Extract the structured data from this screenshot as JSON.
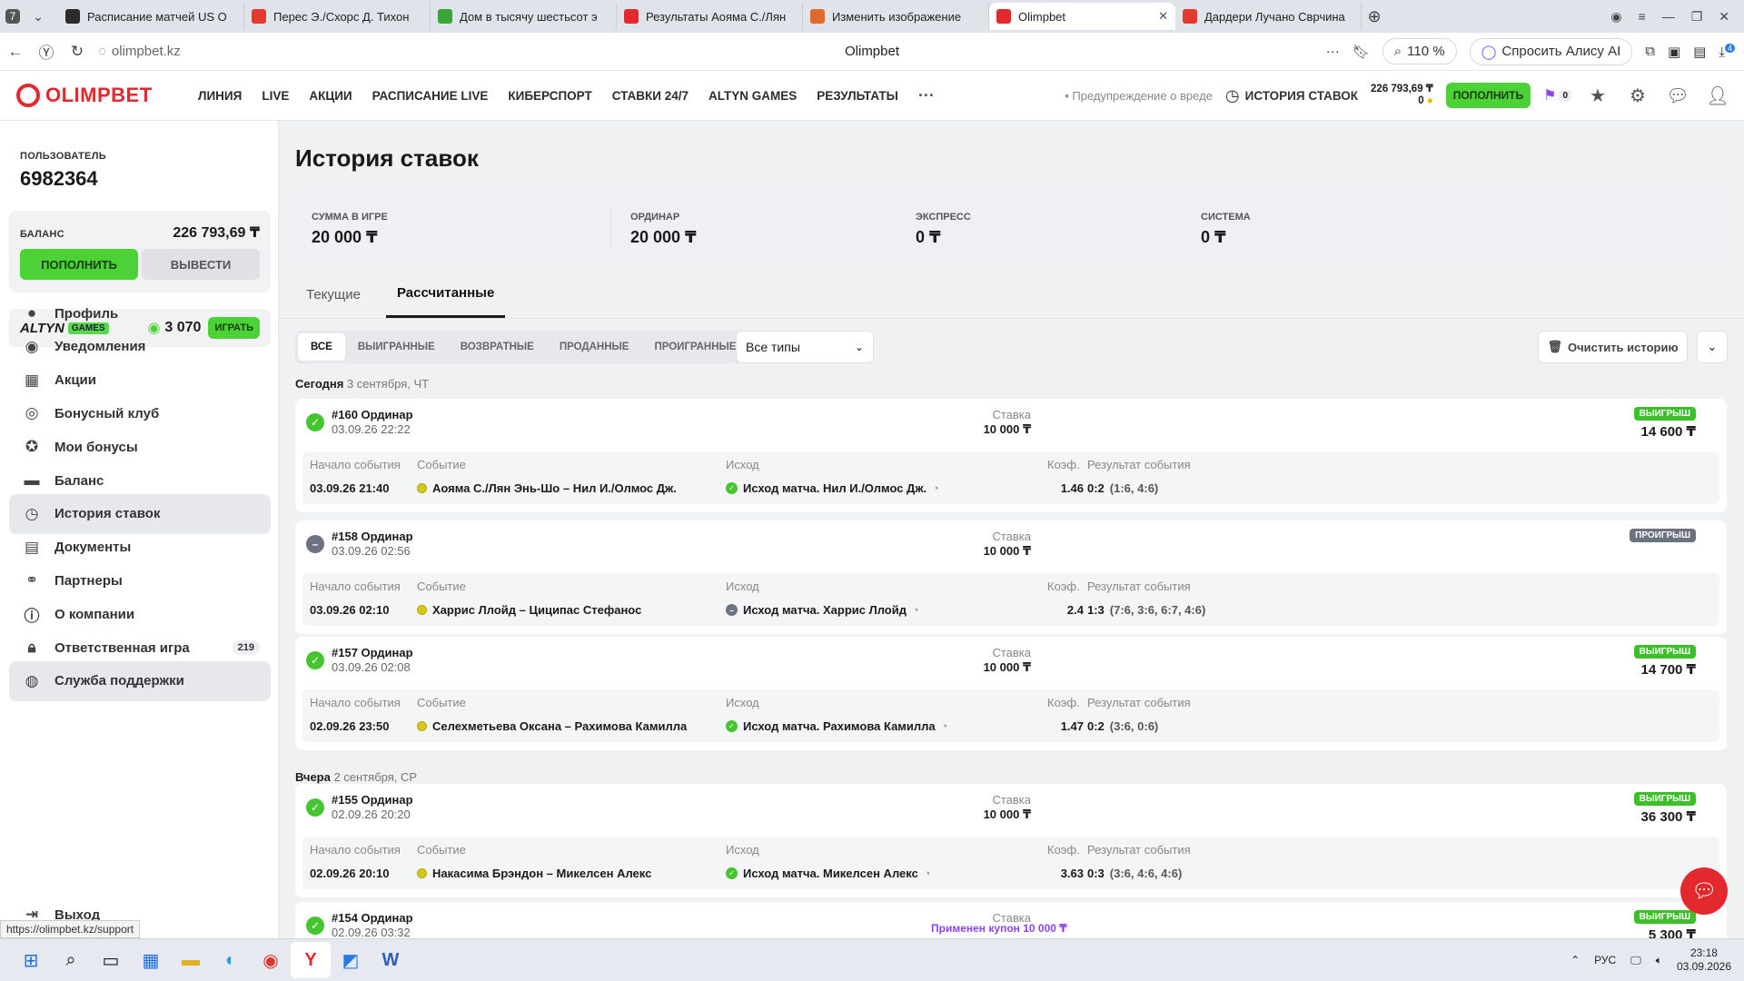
{
  "browser": {
    "tabs": [
      {
        "title": "Расписание матчей US O",
        "color": "#2b2b2b"
      },
      {
        "title": "Перес Э./Схорс Д. Тихон",
        "color": "#e23a2e"
      },
      {
        "title": "Дом в тысячу шестьсот э",
        "color": "#3aa63a"
      },
      {
        "title": "Результаты Аояма С./Лян",
        "color": "#e3282e"
      },
      {
        "title": "Изменить изображение",
        "color": "#e06a2e"
      },
      {
        "title": "Olimpbet",
        "color": "#e3282e",
        "active": true
      },
      {
        "title": "Дардери Лучано Сврчина",
        "color": "#e23a2e"
      }
    ],
    "tab_count": "7",
    "url": "olimpbet.kz",
    "page_title": "Olimpbet",
    "zoom": "110 %",
    "alice": "Спросить Алису AI",
    "ext_badge": "4"
  },
  "header": {
    "logo": "OLIMPBET",
    "menu": [
      "ЛИНИЯ",
      "LIVE",
      "АКЦИИ",
      "РАСПИСАНИЕ LIVE",
      "КИБЕРСПОРТ",
      "СТАВКИ 24/7",
      "ALTYN GAMES",
      "РЕЗУЛЬТАТЫ"
    ],
    "warning": "• Предупреждение о вреде",
    "history": "ИСТОРИЯ СТАВОК",
    "balance": "226 793,69 ₸",
    "bonus": "0",
    "topup": "ПОПОЛНИТЬ",
    "notif_count": "0"
  },
  "sidebar": {
    "user_label": "ПОЛЬЗОВАТЕЛЬ",
    "user_id": "6982364",
    "balance_label": "БАЛАНС",
    "balance": "226 793,69 ₸",
    "topup": "ПОПОЛНИТЬ",
    "withdraw": "ВЫВЕСТИ",
    "altyn_logo": "ALTYN",
    "altyn_badge": "GAMES",
    "altyn_points": "3 070",
    "play": "ИГРАТЬ",
    "items": [
      {
        "label": "Профиль",
        "icon": "person-icon"
      },
      {
        "label": "Уведомления",
        "icon": "bell-icon"
      },
      {
        "label": "Акции",
        "icon": "gift-icon"
      },
      {
        "label": "Бонусный клуб",
        "icon": "coin-icon"
      },
      {
        "label": "Мои бонусы",
        "icon": "star-icon"
      },
      {
        "label": "Баланс",
        "icon": "wallet-icon"
      },
      {
        "label": "История ставок",
        "icon": "clock-icon",
        "selected": true
      },
      {
        "label": "Документы",
        "icon": "document-icon"
      },
      {
        "label": "Партнеры",
        "icon": "handshake-icon"
      },
      {
        "label": "О компании",
        "icon": "info-icon"
      },
      {
        "label": "Ответственная игра",
        "icon": "lock-icon",
        "count": "219"
      },
      {
        "label": "Служба поддержки",
        "icon": "support-icon",
        "selected": true
      }
    ],
    "logout": "Выход",
    "status_url": "https://olimpbet.kz/support"
  },
  "main": {
    "title": "История ставок",
    "summary": [
      {
        "label": "СУММА В ИГРЕ",
        "value": "20 000 ₸"
      },
      {
        "label": "ОРДИНАР",
        "value": "20 000 ₸"
      },
      {
        "label": "ЭКСПРЕСС",
        "value": "0 ₸"
      },
      {
        "label": "СИСТЕМА",
        "value": "0 ₸"
      }
    ],
    "tabs": [
      {
        "label": "Текущие"
      },
      {
        "label": "Рассчитанные",
        "active": true
      }
    ],
    "filters": [
      {
        "label": "ВСЕ",
        "active": true
      },
      {
        "label": "ВЫИГРАННЫЕ"
      },
      {
        "label": "ВОЗВРАТНЫЕ"
      },
      {
        "label": "ПРОДАННЫЕ"
      },
      {
        "label": "ПРОИГРАННЫЕ"
      }
    ],
    "type_select": "Все типы",
    "clear": "Очистить историю",
    "labels": {
      "start": "Начало события",
      "event": "Событие",
      "outcome": "Исход",
      "coef": "Коэф.",
      "result": "Результат события",
      "stake": "Ставка"
    },
    "days": [
      {
        "name": "Сегодня",
        "date": "3 сентября, ЧТ"
      },
      {
        "name": "Вчера",
        "date": "2 сентября, СР"
      }
    ],
    "bets": [
      {
        "title": "#160 Ординар",
        "date": "03.09.26 22:22",
        "stake": "10 000 ₸",
        "status": "win",
        "badge": "ВЫИГРЫШ",
        "payout": "14 600 ₸",
        "start": "03.09.26 21:40",
        "event": "Аояма С./Лян Энь-Шо – Нил И./Олмос Дж.",
        "outcome": "Исход матча. Нил И./Олмос Дж.",
        "coef": "1.46",
        "score": "0:2",
        "sets": "(1:6, 4:6)"
      },
      {
        "title": "#158 Ординар",
        "date": "03.09.26 02:56",
        "stake": "10 000 ₸",
        "status": "lose",
        "badge": "ПРОИГРЫШ",
        "payout": "",
        "start": "03.09.26 02:10",
        "event": "Харрис Ллойд – Циципас Стефанос",
        "outcome": "Исход матча. Харрис Ллойд",
        "coef": "2.4",
        "score": "1:3",
        "sets": "(7:6, 3:6, 6:7, 4:6)"
      },
      {
        "title": "#157 Ординар",
        "date": "03.09.26 02:08",
        "stake": "10 000 ₸",
        "status": "win",
        "badge": "ВЫИГРЫШ",
        "payout": "14 700 ₸",
        "start": "02.09.26 23:50",
        "event": "Селехметьева Оксана – Рахимова Камилла",
        "outcome": "Исход матча. Рахимова Камилла",
        "coef": "1.47",
        "score": "0:2",
        "sets": "(3:6, 0:6)"
      },
      {
        "title": "#155 Ординар",
        "date": "02.09.26 20:20",
        "stake": "10 000 ₸",
        "status": "win",
        "badge": "ВЫИГРЫШ",
        "payout": "36 300 ₸",
        "start": "02.09.26 20:10",
        "event": "Накасима Брэндон – Микелсен Алекс",
        "outcome": "Исход матча. Микелсен Алекс",
        "coef": "3.63",
        "score": "0:3",
        "sets": "(3:6, 4:6, 4:6)"
      },
      {
        "title": "#154 Ординар",
        "date": "02.09.26 03:32",
        "stake": "",
        "status": "win",
        "badge": "ВЫИГРЫШ",
        "payout": "5 300 ₸",
        "coupon": "Применен купон 10 000 ₸"
      }
    ]
  },
  "taskbar": {
    "lang": "РУС",
    "time": "23:18",
    "date": "03.09.2026"
  },
  "colors": {
    "brand": "#e3282e",
    "win": "#45c52f",
    "lose": "#6b7280",
    "coupon": "#8e44ec"
  }
}
